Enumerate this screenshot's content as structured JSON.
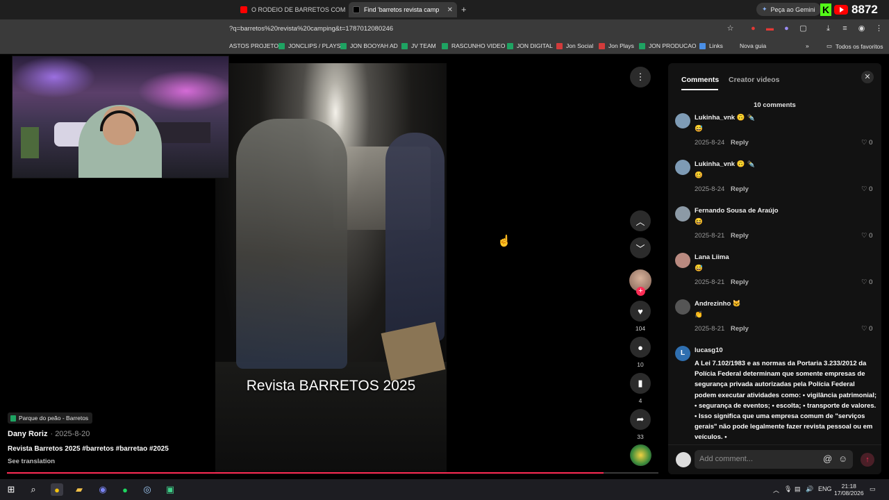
{
  "browser": {
    "tabs": [
      {
        "title": "O RODEIO DE BARRETOS COM",
        "active": false
      },
      {
        "title": "Find 'barretos revista camp",
        "active": true
      }
    ],
    "gemini_label": "Peça ao Gemini",
    "viewer_count": "8872",
    "url": "?q=barretos%20revista%20camping&t=1787012080246",
    "bookmarks": [
      "ASTOS PROJETO",
      "JONCLIPS / PLAYS",
      "JON BOOYAH AD",
      "JV TEAM",
      "RASCUNHO VIDEO",
      "JON DIGITAL",
      "Jon Social",
      "Jon Plays",
      "JON PRODUCAO",
      "Links",
      "Nova guia"
    ],
    "favorites_label": "Todos os favoritos"
  },
  "video": {
    "caption": "Revista BARRETOS 2025",
    "location": "Parque do peão - Barretos",
    "author": "Dany Roriz",
    "date": "· 2025-8-20",
    "description": "Revista Barretos 2025 #barretos #barretao #2025",
    "see_translation": "See translation",
    "progress_fraction": 0.916
  },
  "actions": {
    "likes": "104",
    "comments": "10",
    "saves": "4",
    "shares": "33"
  },
  "panel": {
    "tab_comments": "Comments",
    "tab_creator": "Creator videos",
    "count_label": "10 comments",
    "comments": [
      {
        "name": "Lukinha_vnk 🙃 ✒️",
        "text": "😅",
        "date": "2025-8-24",
        "reply": "Reply",
        "likes": "♡ 0"
      },
      {
        "name": "Lukinha_vnk 🙃 ✒️",
        "text": "🥴",
        "date": "2025-8-24",
        "reply": "Reply",
        "likes": "♡ 0"
      },
      {
        "name": "Fernando Sousa de Araújo",
        "text": "😆",
        "date": "2025-8-21",
        "reply": "Reply",
        "likes": "♡ 0"
      },
      {
        "name": "Lana Liima",
        "text": "😅",
        "date": "2025-8-21",
        "reply": "Reply",
        "likes": "♡ 0"
      },
      {
        "name": "Andrezinho 🐱",
        "text": "👏",
        "date": "2025-8-21",
        "reply": "Reply",
        "likes": "♡ 0"
      }
    ],
    "long_comment": {
      "initial": "L",
      "name": "lucasg10",
      "text": "A Lei 7.102/1983 e as normas da Portaria 3.233/2012 da Polícia Federal determinam que somente empresas de segurança privada autorizadas pela Polícia Federal podem executar atividades como: • vigilância patrimonial; • segurança de eventos; • escolta; • transporte de valores. • Isso significa que uma empresa comum de \"serviços gerais\" não pode legalmente fazer revista pessoal ou em veículos. •"
    },
    "add_comment_placeholder": "Add comment..."
  },
  "taskbar": {
    "lang": "ENG",
    "time": "21:18",
    "date": "17/08/2026"
  },
  "colors": {
    "accent": "#fe2c55",
    "bookmark_green": "#1ea362",
    "kick_green": "#53fc18",
    "youtube_red": "#ff0000"
  }
}
